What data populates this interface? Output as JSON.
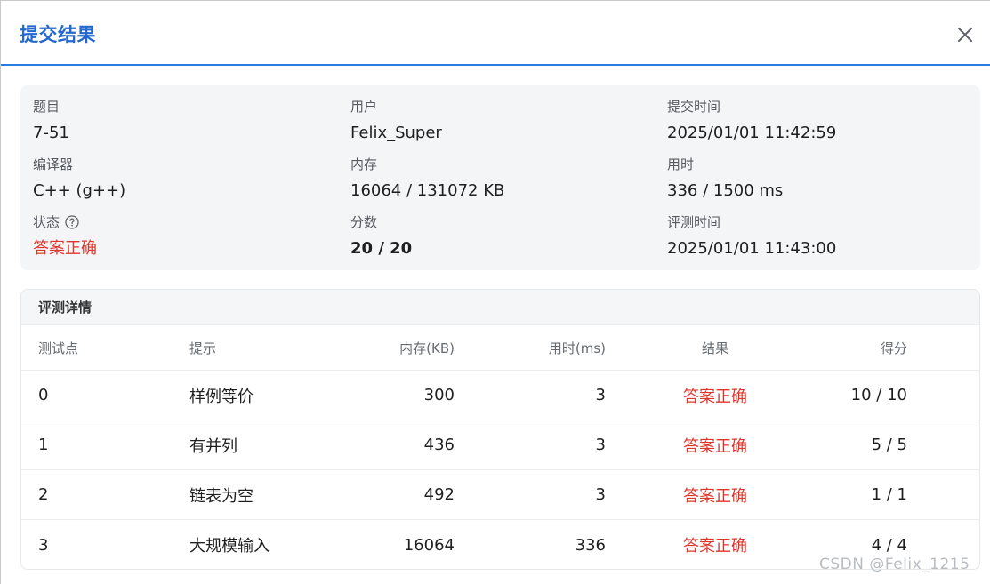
{
  "dialog": {
    "title": "提交结果"
  },
  "summary": {
    "problem_label": "题目",
    "problem": "7-51",
    "user_label": "用户",
    "user": "Felix_Super",
    "submit_time_label": "提交时间",
    "submit_time": "2025/01/01 11:42:59",
    "compiler_label": "编译器",
    "compiler": "C++ (g++)",
    "memory_label": "内存",
    "memory": "16064 / 131072 KB",
    "time_label": "用时",
    "time": "336 / 1500 ms",
    "status_label": "状态",
    "status": "答案正确",
    "score_label": "分数",
    "score": "20 / 20",
    "judge_time_label": "评测时间",
    "judge_time": "2025/01/01 11:43:00"
  },
  "details": {
    "title": "评测详情",
    "columns": [
      "测试点",
      "提示",
      "内存(KB)",
      "用时(ms)",
      "结果",
      "得分"
    ],
    "rows": [
      {
        "id": "0",
        "hint": "样例等价",
        "memory": "300",
        "time": "3",
        "result": "答案正确",
        "score": "10 / 10"
      },
      {
        "id": "1",
        "hint": "有并列",
        "memory": "436",
        "time": "3",
        "result": "答案正确",
        "score": "5 / 5"
      },
      {
        "id": "2",
        "hint": "链表为空",
        "memory": "492",
        "time": "3",
        "result": "答案正确",
        "score": "1 / 1"
      },
      {
        "id": "3",
        "hint": "大规模输入",
        "memory": "16064",
        "time": "336",
        "result": "答案正确",
        "score": "4 / 4"
      }
    ]
  },
  "watermark": "CSDN @Felix_1215",
  "colors": {
    "accent": "#2468cc",
    "success_text": "#e0352b"
  }
}
